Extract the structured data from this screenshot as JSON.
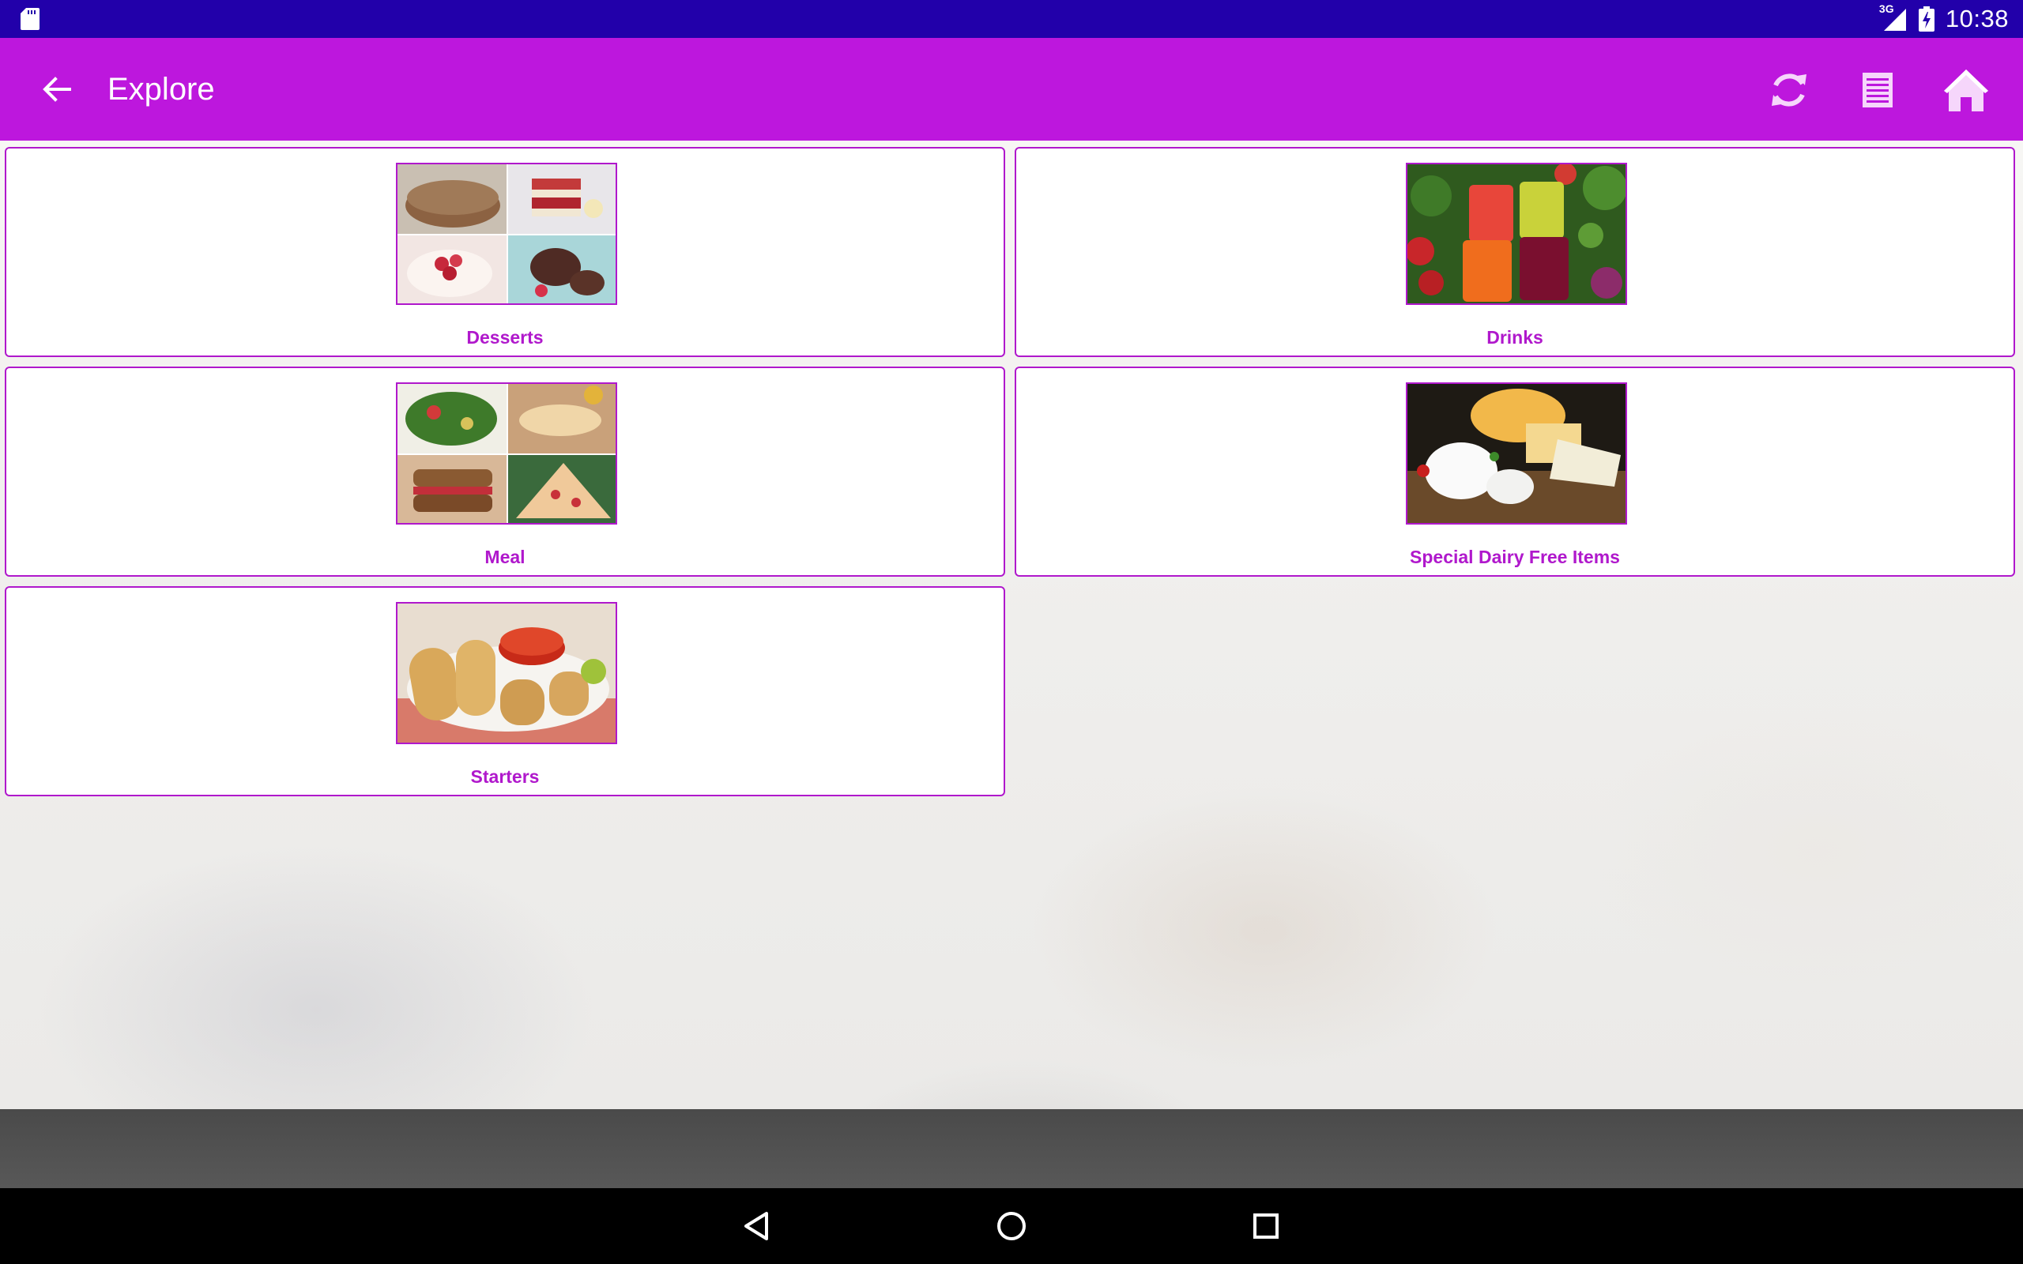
{
  "status_bar": {
    "network": "3G",
    "time": "10:38",
    "icons": [
      "sd-card-icon",
      "signal-icon",
      "battery-charging-icon"
    ]
  },
  "app_bar": {
    "title": "Explore",
    "actions": [
      "back-arrow-icon",
      "refresh-icon",
      "list-icon",
      "home-icon"
    ],
    "color": "#bd17dd"
  },
  "categories": [
    {
      "label": "Desserts"
    },
    {
      "label": "Drinks"
    },
    {
      "label": "Meal"
    },
    {
      "label": "Special Dairy Free Items"
    },
    {
      "label": "Starters"
    }
  ],
  "nav_bar": {
    "buttons": [
      "back-triangle-icon",
      "home-circle-icon",
      "recents-square-icon"
    ]
  },
  "colors": {
    "status_bar": "#2200aa",
    "accent": "#b018cc"
  }
}
